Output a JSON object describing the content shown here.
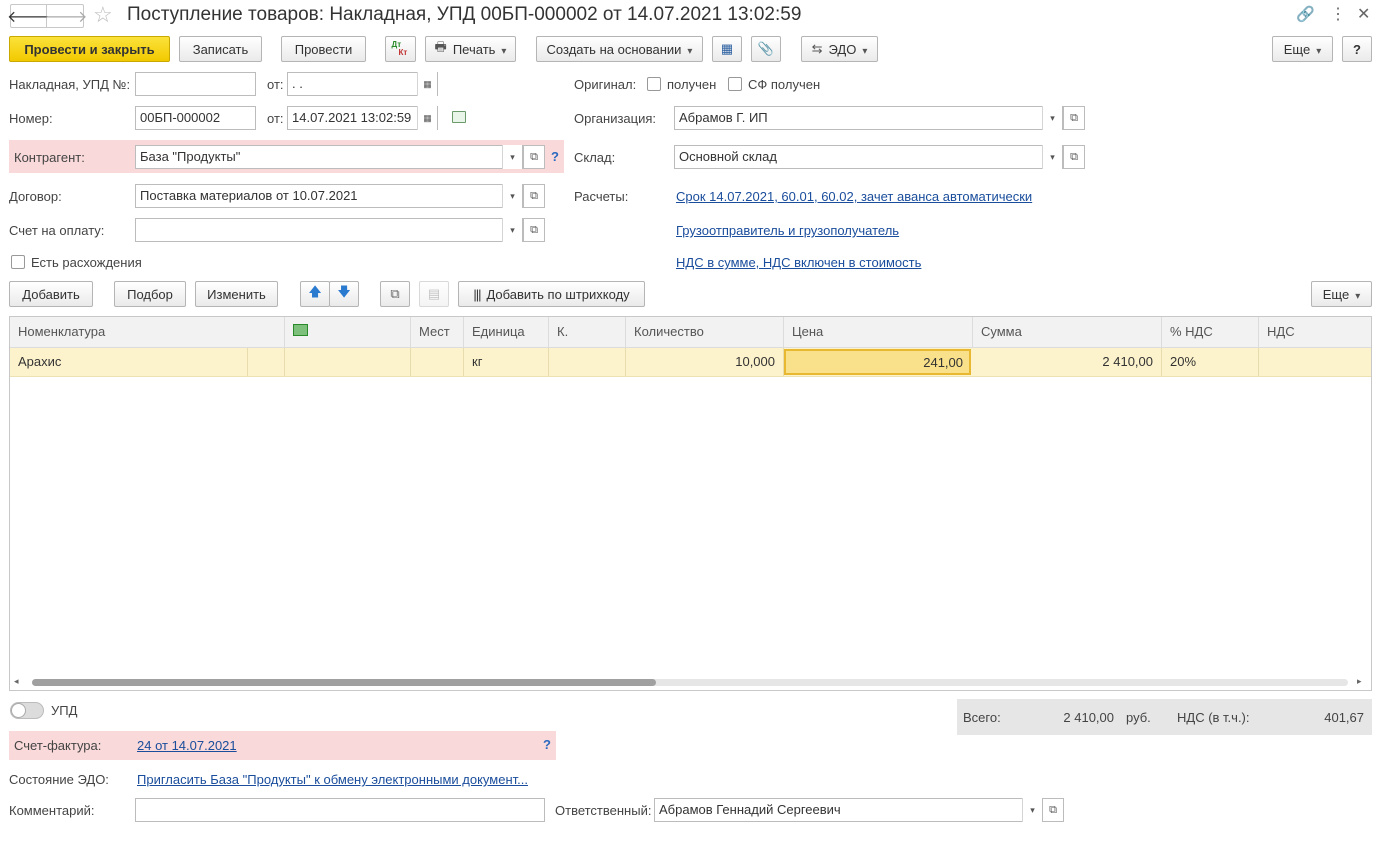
{
  "window": {
    "title": "Поступление товаров: Накладная, УПД 00БП-000002 от 14.07.2021 13:02:59"
  },
  "toolbar": {
    "post_close": "Провести и закрыть",
    "save": "Записать",
    "post": "Провести",
    "dtkt_dt": "Дт",
    "dtkt_kt": "Кт",
    "print": "Печать",
    "create_based": "Создать на основании",
    "edo": "ЭДО",
    "more": "Еще",
    "help": "?"
  },
  "form": {
    "invoice_no_label": "Накладная, УПД №:",
    "invoice_no_value": "",
    "from_label": "от:",
    "invoice_date_value": " .  .",
    "number_label": "Номер:",
    "number_value": "00БП-000002",
    "date_value": "14.07.2021 13:02:59",
    "counterparty_label": "Контрагент:",
    "counterparty_value": "База \"Продукты\"",
    "contract_label": "Договор:",
    "contract_value": "Поставка материалов от 10.07.2021",
    "payment_account_label": "Счет на оплату:",
    "payment_account_value": "",
    "discrepancy_label": "Есть расхождения",
    "original_label": "Оригинал:",
    "received_label": "получен",
    "sf_received_label": "СФ получен",
    "org_label": "Организация:",
    "org_value": "Абрамов Г. ИП",
    "warehouse_label": "Склад:",
    "warehouse_value": "Основной склад",
    "settlements_label": "Расчеты:",
    "settlements_link": "Срок 14.07.2021, 60.01, 60.02, зачет аванса автоматически",
    "shipper_link": "Грузоотправитель и грузополучатель",
    "vat_link": "НДС в сумме, НДС включен в стоимость"
  },
  "table_toolbar": {
    "add": "Добавить",
    "select": "Подбор",
    "change": "Изменить",
    "barcode": "Добавить по штрихкоду",
    "more": "Еще"
  },
  "table": {
    "headers": [
      "Номенклатура",
      "",
      "Мест",
      "Единица",
      "К.",
      "Количество",
      "Цена",
      "Сумма",
      "% НДС",
      "НДС"
    ],
    "rows": [
      {
        "name": "Арахис",
        "extra": "",
        "places": "",
        "unit": "кг",
        "k": "",
        "qty": "10,000",
        "price": "241,00",
        "sum": "2 410,00",
        "vat_rate": "20%",
        "vat": ""
      }
    ]
  },
  "footer": {
    "upd_label": "УПД",
    "invoice_label": "Счет-фактура:",
    "invoice_link": "24 от 14.07.2021",
    "help": "?",
    "edo_state_label": "Состояние ЭДО:",
    "edo_state_link": "Пригласить База \"Продукты\"  к обмену электронными документ...",
    "comment_label": "Комментарий:",
    "comment_value": "",
    "responsible_label": "Ответственный:",
    "responsible_value": "Абрамов Геннадий Сергеевич",
    "total_label": "Всего:",
    "total_value": "2 410,00",
    "currency": "руб.",
    "vat_incl_label": "НДС (в т.ч.):",
    "vat_incl_value": "401,67"
  }
}
